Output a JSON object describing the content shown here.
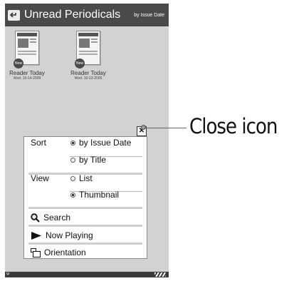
{
  "header": {
    "title": "Unread Periodicals",
    "sort_label": "by Issue Date"
  },
  "icons": {
    "back": "back-arrow-icon",
    "close": "close-icon",
    "search": "magnifier-icon",
    "now_playing": "play-triangle-icon",
    "orientation": "rotate-screen-icon"
  },
  "periodicals": [
    {
      "masthead": "The Reader Today",
      "badge": "New",
      "title": "Reader Today",
      "date": "Wed. 10-14-2009"
    },
    {
      "masthead": "The Reader Today",
      "badge": "New",
      "title": "Reader Today",
      "date": "Wed. 10-13-2009"
    }
  ],
  "menu": {
    "sort": {
      "label": "Sort",
      "options": [
        "by Issue Date",
        "by Title"
      ],
      "selected": "by Issue Date"
    },
    "view": {
      "label": "View",
      "options": [
        "List",
        "Thumbnail"
      ],
      "selected": "Thumbnail"
    },
    "items": [
      "Search",
      "Now Playing",
      "Orientation"
    ]
  },
  "status": {
    "signal": "Ψ"
  },
  "callout": {
    "label": "Close icon"
  }
}
